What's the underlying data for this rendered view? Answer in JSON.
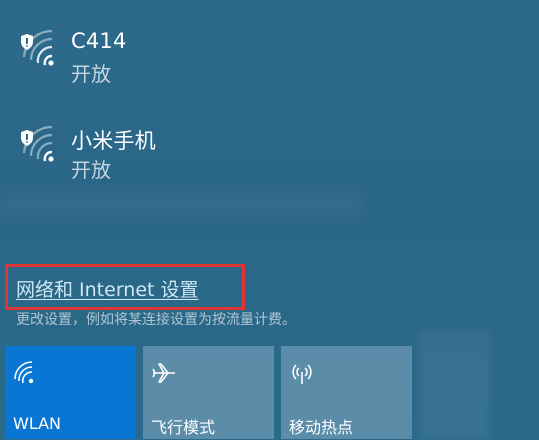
{
  "networks": [
    {
      "name": "C414",
      "status": "开放",
      "icon": "wifi-secured-icon"
    },
    {
      "name": "小米手机",
      "status": "开放",
      "icon": "wifi-secured-icon"
    }
  ],
  "settings": {
    "link_label": "网络和 Internet 设置",
    "description": "更改设置，例如将某连接设置为按流量计费。"
  },
  "quick_actions": [
    {
      "label": "WLAN",
      "icon": "wifi-icon",
      "active": true
    },
    {
      "label": "飞行模式",
      "icon": "airplane-icon",
      "active": false
    },
    {
      "label": "移动热点",
      "icon": "hotspot-icon",
      "active": false
    }
  ],
  "colors": {
    "panel_bg": "#2a6687",
    "active_tile": "#0a76d4",
    "highlight": "#e03434"
  }
}
